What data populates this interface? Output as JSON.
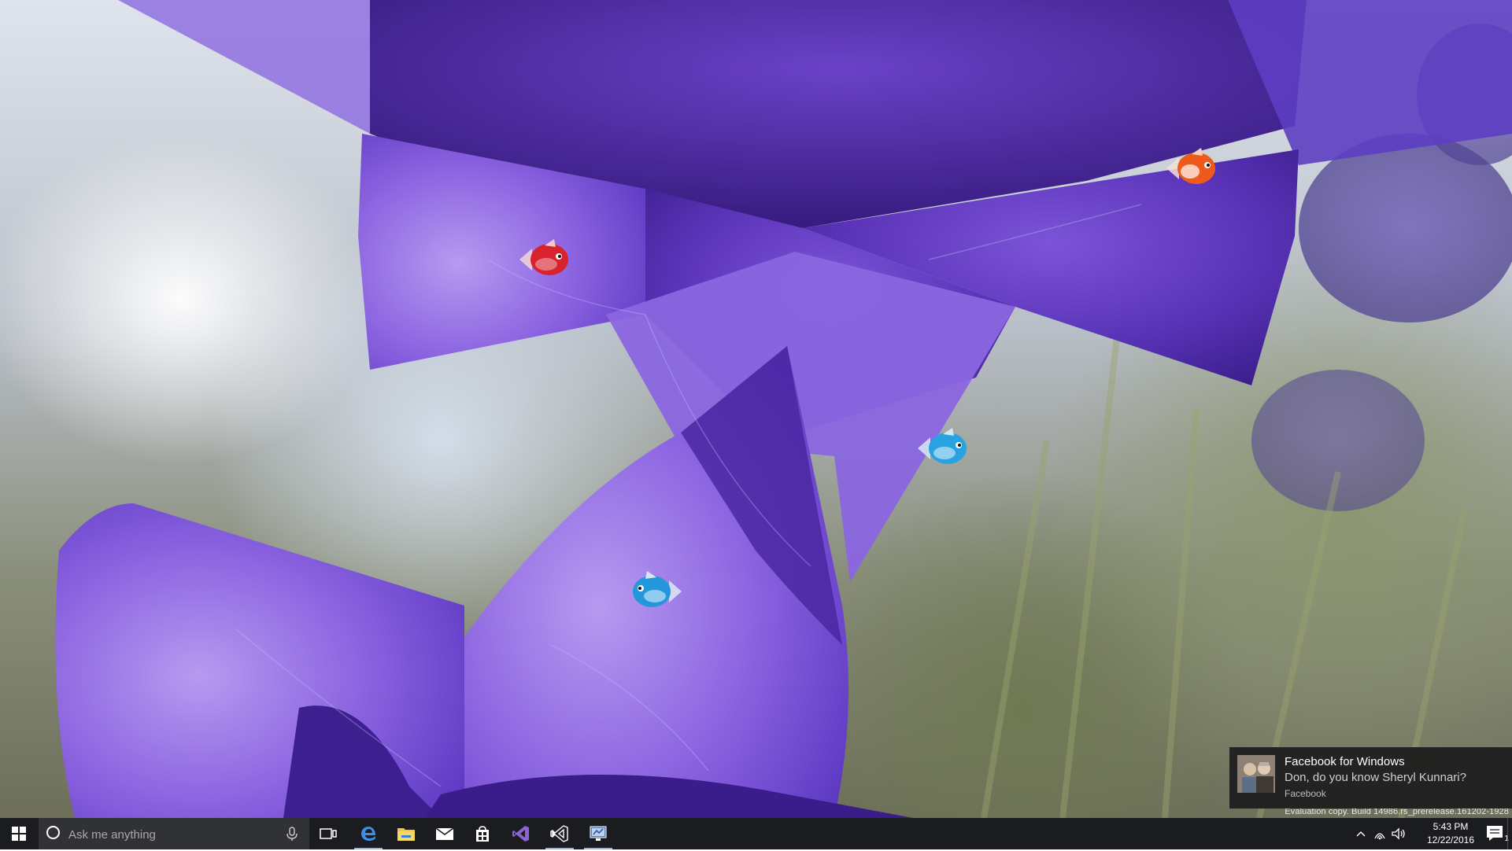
{
  "desktop": {
    "wallpaper": "purple balloon flowers against sky",
    "fish": [
      {
        "name": "fish-red",
        "color": "#d8232f"
      },
      {
        "name": "fish-orange",
        "color": "#ee5a1c"
      },
      {
        "name": "fish-blue-upper",
        "color": "#29a3e0"
      },
      {
        "name": "fish-blue-lower",
        "color": "#2496dc"
      }
    ]
  },
  "watermark": {
    "text": "Evaluation copy. Build 14986.rs_prerelease.161202-1928"
  },
  "toast": {
    "title": "Facebook for Windows",
    "message": "Don, do you know Sheryl Kunnari?",
    "source": "Facebook"
  },
  "taskbar": {
    "search_placeholder": "Ask me anything",
    "pinned": [
      {
        "name": "task-view-icon"
      },
      {
        "name": "edge-icon"
      },
      {
        "name": "file-explorer-icon"
      },
      {
        "name": "mail-icon"
      },
      {
        "name": "store-icon"
      },
      {
        "name": "visual-studio-icon"
      },
      {
        "name": "visual-studio-preview-icon"
      },
      {
        "name": "remote-desktop-icon"
      }
    ],
    "accent": "#9db4d8"
  },
  "tray": {
    "time": "5:43 PM",
    "date": "12/22/2016",
    "notification_count": "1"
  }
}
